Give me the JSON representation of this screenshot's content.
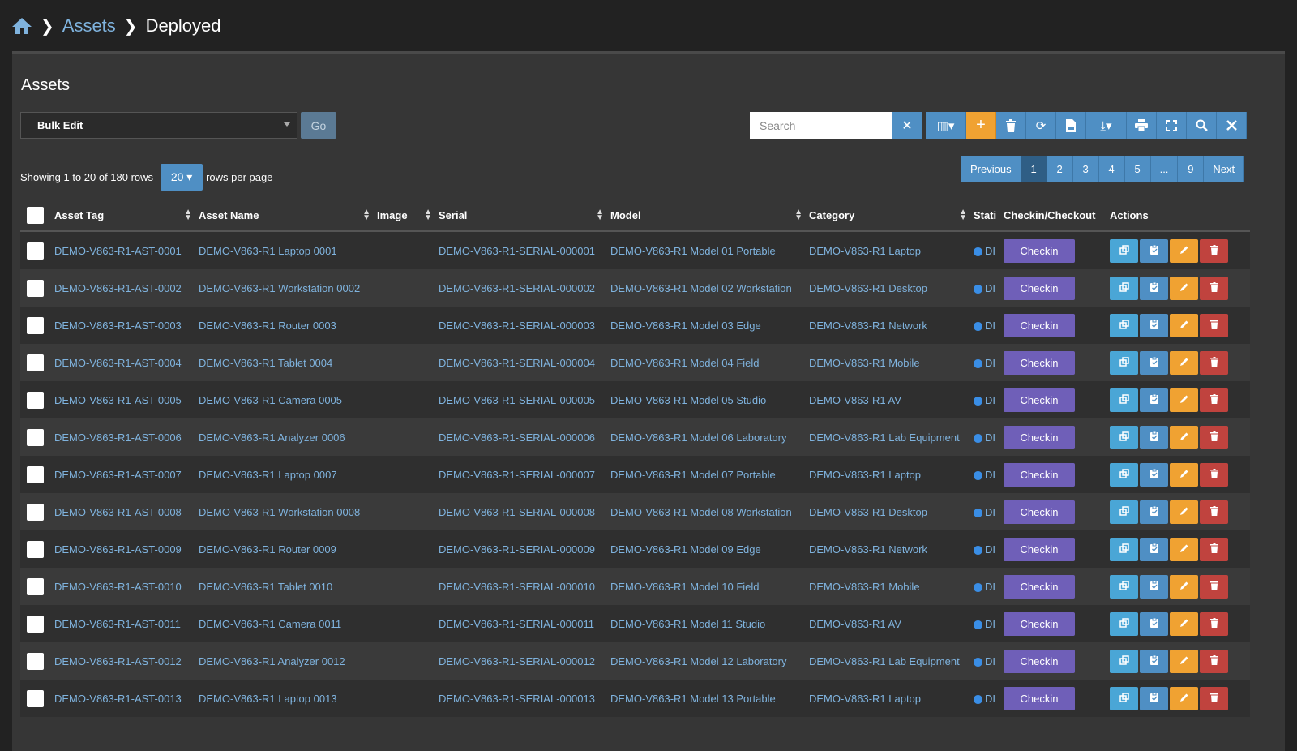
{
  "breadcrumb": {
    "home_icon": "home-icon",
    "items": [
      "Assets",
      "Deployed"
    ]
  },
  "panel": {
    "title": "Assets"
  },
  "bulk": {
    "selected": "Bulk Edit",
    "go_label": "Go"
  },
  "search": {
    "placeholder": "Search",
    "clear": "✕"
  },
  "toolbar": {
    "buttons": [
      {
        "name": "columns-icon",
        "glyph": "▥▾"
      },
      {
        "name": "add-icon",
        "glyph": "+"
      },
      {
        "name": "trash-icon",
        "glyph": "🗑"
      },
      {
        "name": "refresh-icon",
        "glyph": "⟳"
      },
      {
        "name": "csv-icon",
        "glyph": "⎙"
      },
      {
        "name": "export-icon",
        "glyph": "⤓▾"
      },
      {
        "name": "print-icon",
        "glyph": "⎙"
      },
      {
        "name": "fullscreen-icon",
        "glyph": "⛶"
      },
      {
        "name": "zoom-icon",
        "glyph": "🔍"
      },
      {
        "name": "advanced-search-icon",
        "glyph": "✖"
      }
    ]
  },
  "rows_info": {
    "prefix": "Showing 1 to 20 of 180 rows",
    "per_page": "20 ▾",
    "suffix": "rows per page"
  },
  "pagination": [
    "Previous",
    "1",
    "2",
    "3",
    "4",
    "5",
    "...",
    "9",
    "Next"
  ],
  "pagination_active": "1",
  "table": {
    "columns": [
      "Asset Tag",
      "Asset Name",
      "Image",
      "Serial",
      "Model",
      "Category",
      "Stati",
      "Checkin/Checkout",
      "Actions"
    ],
    "status_text": "DI",
    "checkin_label": "Checkin",
    "rows": [
      {
        "tag": "DEMO-V863-R1-AST-0001",
        "name": "DEMO-V863-R1 Laptop 0001",
        "serial": "DEMO-V863-R1-SERIAL-000001",
        "model": "DEMO-V863-R1 Model 01 Portable",
        "category": "DEMO-V863-R1 Laptop"
      },
      {
        "tag": "DEMO-V863-R1-AST-0002",
        "name": "DEMO-V863-R1 Workstation 0002",
        "serial": "DEMO-V863-R1-SERIAL-000002",
        "model": "DEMO-V863-R1 Model 02 Workstation",
        "category": "DEMO-V863-R1 Desktop"
      },
      {
        "tag": "DEMO-V863-R1-AST-0003",
        "name": "DEMO-V863-R1 Router 0003",
        "serial": "DEMO-V863-R1-SERIAL-000003",
        "model": "DEMO-V863-R1 Model 03 Edge",
        "category": "DEMO-V863-R1 Network"
      },
      {
        "tag": "DEMO-V863-R1-AST-0004",
        "name": "DEMO-V863-R1 Tablet 0004",
        "serial": "DEMO-V863-R1-SERIAL-000004",
        "model": "DEMO-V863-R1 Model 04 Field",
        "category": "DEMO-V863-R1 Mobile"
      },
      {
        "tag": "DEMO-V863-R1-AST-0005",
        "name": "DEMO-V863-R1 Camera 0005",
        "serial": "DEMO-V863-R1-SERIAL-000005",
        "model": "DEMO-V863-R1 Model 05 Studio",
        "category": "DEMO-V863-R1 AV"
      },
      {
        "tag": "DEMO-V863-R1-AST-0006",
        "name": "DEMO-V863-R1 Analyzer 0006",
        "serial": "DEMO-V863-R1-SERIAL-000006",
        "model": "DEMO-V863-R1 Model 06 Laboratory",
        "category": "DEMO-V863-R1 Lab Equipment"
      },
      {
        "tag": "DEMO-V863-R1-AST-0007",
        "name": "DEMO-V863-R1 Laptop 0007",
        "serial": "DEMO-V863-R1-SERIAL-000007",
        "model": "DEMO-V863-R1 Model 07 Portable",
        "category": "DEMO-V863-R1 Laptop"
      },
      {
        "tag": "DEMO-V863-R1-AST-0008",
        "name": "DEMO-V863-R1 Workstation 0008",
        "serial": "DEMO-V863-R1-SERIAL-000008",
        "model": "DEMO-V863-R1 Model 08 Workstation",
        "category": "DEMO-V863-R1 Desktop"
      },
      {
        "tag": "DEMO-V863-R1-AST-0009",
        "name": "DEMO-V863-R1 Router 0009",
        "serial": "DEMO-V863-R1-SERIAL-000009",
        "model": "DEMO-V863-R1 Model 09 Edge",
        "category": "DEMO-V863-R1 Network"
      },
      {
        "tag": "DEMO-V863-R1-AST-0010",
        "name": "DEMO-V863-R1 Tablet 0010",
        "serial": "DEMO-V863-R1-SERIAL-000010",
        "model": "DEMO-V863-R1 Model 10 Field",
        "category": "DEMO-V863-R1 Mobile"
      },
      {
        "tag": "DEMO-V863-R1-AST-0011",
        "name": "DEMO-V863-R1 Camera 0011",
        "serial": "DEMO-V863-R1-SERIAL-000011",
        "model": "DEMO-V863-R1 Model 11 Studio",
        "category": "DEMO-V863-R1 AV"
      },
      {
        "tag": "DEMO-V863-R1-AST-0012",
        "name": "DEMO-V863-R1 Analyzer 0012",
        "serial": "DEMO-V863-R1-SERIAL-000012",
        "model": "DEMO-V863-R1 Model 12 Laboratory",
        "category": "DEMO-V863-R1 Lab Equipment"
      },
      {
        "tag": "DEMO-V863-R1-AST-0013",
        "name": "DEMO-V863-R1 Laptop 0013",
        "serial": "DEMO-V863-R1-SERIAL-000013",
        "model": "DEMO-V863-R1 Model 13 Portable",
        "category": "DEMO-V863-R1 Laptop"
      }
    ]
  },
  "colors": {
    "link": "#7fb3de",
    "primary": "#4f8fc4",
    "warning": "#f0a232",
    "danger": "#c0433e",
    "checkin": "#6f5fb8",
    "info": "#4aa6d6"
  }
}
